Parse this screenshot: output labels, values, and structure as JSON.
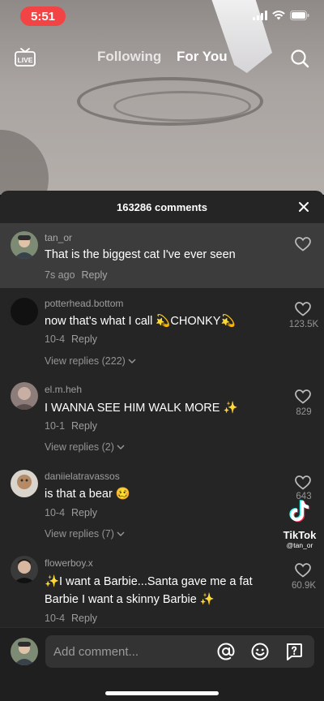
{
  "status_bar": {
    "time": "5:51"
  },
  "top_nav": {
    "live_label": "LIVE",
    "tabs": [
      {
        "label": "Following",
        "active": false
      },
      {
        "label": "For You",
        "active": true
      }
    ]
  },
  "comments_panel": {
    "title": "163286 comments",
    "comments": [
      {
        "username": "tan_or",
        "text": "That is the biggest cat I've ever seen",
        "time": "7s ago",
        "reply": "Reply",
        "likes": "",
        "view_replies": "",
        "highlighted": true
      },
      {
        "username": "potterhead.bottom",
        "text": "now that's what I call 💫CHONKY💫",
        "time": "10-4",
        "reply": "Reply",
        "likes": "123.5K",
        "view_replies": "View replies (222)"
      },
      {
        "username": "el.m.heh",
        "text": "I WANNA SEE HIM WALK MORE ✨",
        "time": "10-1",
        "reply": "Reply",
        "likes": "829",
        "view_replies": "View replies (2)"
      },
      {
        "username": "daniielatravassos",
        "text": "is that a bear 🥴",
        "time": "10-4",
        "reply": "Reply",
        "likes": "643",
        "view_replies": "View replies (7)"
      },
      {
        "username": "flowerboy.x",
        "text": "✨I want a Barbie...Santa gave me a fat Barbie I want a skinny Barbie ✨",
        "time": "10-4",
        "reply": "Reply",
        "likes": "60.9K",
        "view_replies": ""
      }
    ]
  },
  "watermark": {
    "brand": "TikTok",
    "user": "@tan_or"
  },
  "input_bar": {
    "placeholder": "Add comment..."
  },
  "colors": {
    "status_pill": "#f24444",
    "sheet_bg": "#252525",
    "highlight_bg": "#3c3c3c"
  }
}
